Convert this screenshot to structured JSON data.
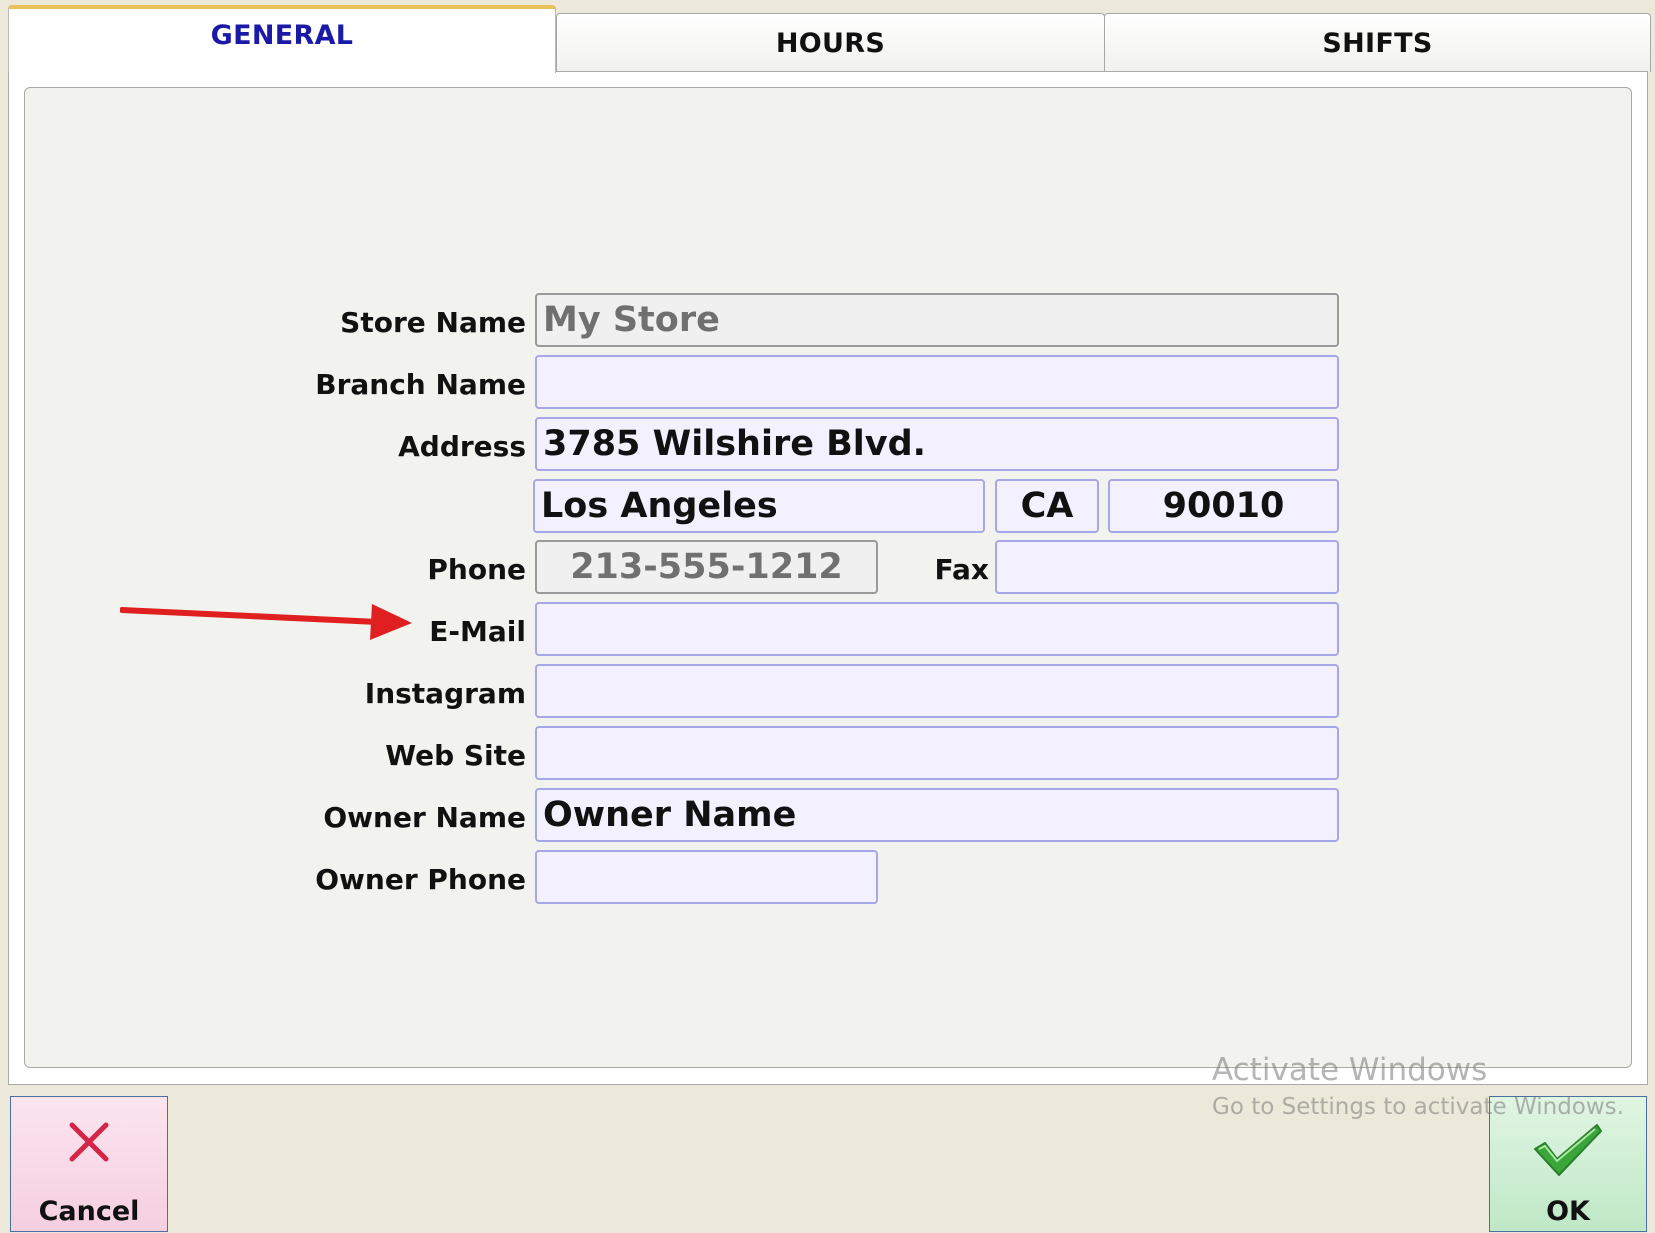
{
  "tabs": [
    {
      "label": "GENERAL",
      "active": true
    },
    {
      "label": "HOURS",
      "active": false
    },
    {
      "label": "SHIFTS",
      "active": false
    }
  ],
  "form": {
    "store_name": {
      "label": "Store Name",
      "value": "My Store"
    },
    "branch_name": {
      "label": "Branch Name",
      "value": ""
    },
    "address": {
      "label": "Address",
      "value": "3785 Wilshire Blvd."
    },
    "city": {
      "value": "Los Angeles"
    },
    "state": {
      "value": "CA"
    },
    "zip": {
      "value": "90010"
    },
    "phone": {
      "label": "Phone",
      "value": "213-555-1212"
    },
    "fax": {
      "label": "Fax",
      "value": ""
    },
    "email": {
      "label": "E-Mail",
      "value": ""
    },
    "instagram": {
      "label": "Instagram",
      "value": ""
    },
    "website": {
      "label": "Web Site",
      "value": ""
    },
    "owner_name": {
      "label": "Owner Name",
      "value": "Owner Name"
    },
    "owner_phone": {
      "label": "Owner Phone",
      "value": ""
    }
  },
  "buttons": {
    "cancel_label": "Cancel",
    "ok_label": "OK"
  },
  "watermark": {
    "line1": "Activate Windows",
    "line2": "Go to Settings to activate Windows."
  },
  "icons": {
    "cancel": "x-icon",
    "ok": "checkmark-icon",
    "annotation": "red-arrow-icon"
  },
  "colors": {
    "active_tab_text": "#1a1aa6",
    "active_tab_accent": "#e8c15a",
    "field_bg": "#f3f1ff",
    "field_border": "#a6a6e8",
    "arrow": "#e02020",
    "cancel_icon": "#d32545",
    "ok_icon": "#3aa63a"
  }
}
